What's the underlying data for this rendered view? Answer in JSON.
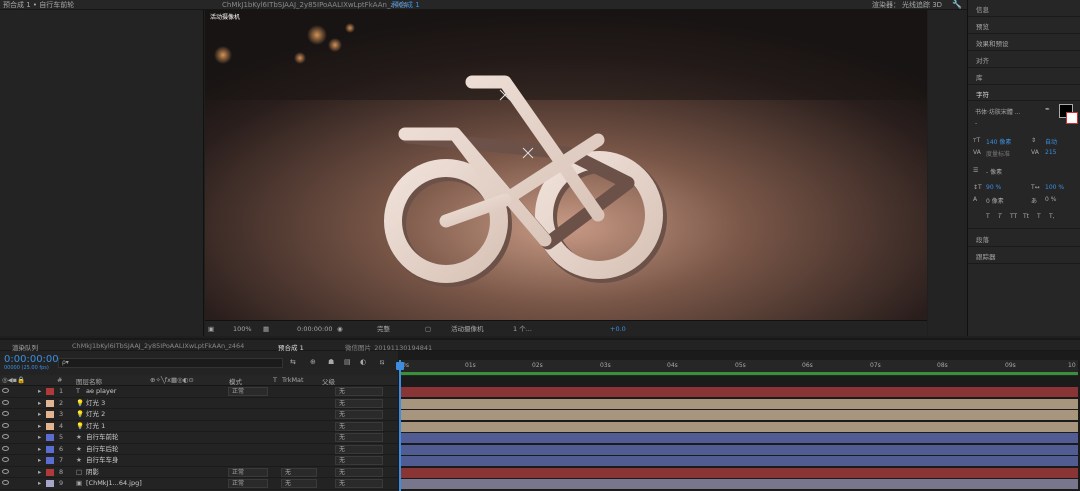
{
  "topbar": {
    "left_title": "预合成 1 • 自行车前轮",
    "comp_tab": "ChMkJ1bKyl6ITbSJAAJ_2y85IPoAALIXwLptFkAAn_z464",
    "active_tab": "预合成 1",
    "renderer_label": "渲染器：",
    "renderer_value": "光线追踪 3D"
  },
  "viewer": {
    "camera_badge": "活动摄像机"
  },
  "viewer_toolbar": {
    "zoom": "100%",
    "timecode": "0:00:00:00",
    "quality": "完整",
    "camera": "活动摄像机",
    "views": "1 个...",
    "exposure": "+0.0"
  },
  "right_panel": {
    "items": [
      "信息",
      "预览",
      "效果和预设",
      "对齐",
      "库",
      "字符"
    ],
    "font_name": "书体·坊肤宋體 ...",
    "font_style": "-",
    "font_size": "140 像素",
    "leading": "自动",
    "tracking_label": "度量标准",
    "tracking_value": "215",
    "stroke_width": "- 像素",
    "vscale": "90 %",
    "hscale": "100 %",
    "baseline": "0 像素",
    "tsume": "0 %",
    "style_buttons": [
      "T",
      "T",
      "TT",
      "Tt",
      "T",
      "T,"
    ],
    "paragraph": "段落",
    "tracker": "跟踪器"
  },
  "timeline": {
    "tabs": [
      "渲染队列",
      "ChMkJ1bKyl6ITbSJAAJ_2y85IPoAALIXwLptFkAAn_z464",
      "预合成 1",
      "微信图片_20191130194841"
    ],
    "timecode": "0:00:00:00",
    "fps_info": "00000 (25.00 fps)",
    "search_placeholder": "ρ▾",
    "columns": {
      "num": "#",
      "name": "图层名称",
      "mode": "模式",
      "t": "T",
      "trkmat": "TrkMat",
      "parent": "父级"
    },
    "ruler": [
      "0s",
      "01s",
      "02s",
      "03s",
      "04s",
      "05s",
      "06s",
      "07s",
      "08s",
      "09s",
      "10"
    ],
    "layers": [
      {
        "num": "1",
        "type": "T",
        "name": "ae player",
        "color": "#b03a3a",
        "mode": "正常",
        "trkmat": "",
        "parent": "无",
        "bar": "#8a3535"
      },
      {
        "num": "2",
        "type": "💡",
        "name": "灯光 3",
        "color": "#e2b592",
        "mode": "",
        "trkmat": "",
        "parent": "无",
        "bar": "#a8957e"
      },
      {
        "num": "3",
        "type": "💡",
        "name": "灯光 2",
        "color": "#e2b592",
        "mode": "",
        "trkmat": "",
        "parent": "无",
        "bar": "#a8957e"
      },
      {
        "num": "4",
        "type": "💡",
        "name": "灯光 1",
        "color": "#e2b592",
        "mode": "",
        "trkmat": "",
        "parent": "无",
        "bar": "#a8957e"
      },
      {
        "num": "5",
        "type": "★",
        "name": "自行车前轮",
        "color": "#5b6dd0",
        "mode": "",
        "trkmat": "",
        "parent": "无",
        "bar": "#515d92"
      },
      {
        "num": "6",
        "type": "★",
        "name": "自行车后轮",
        "color": "#5b6dd0",
        "mode": "",
        "trkmat": "",
        "parent": "无",
        "bar": "#515d92"
      },
      {
        "num": "7",
        "type": "★",
        "name": "自行车车身",
        "color": "#5b6dd0",
        "mode": "",
        "trkmat": "",
        "parent": "无",
        "bar": "#515d92"
      },
      {
        "num": "8",
        "type": "□",
        "name": "阴影",
        "color": "#b03a3a",
        "mode": "正常",
        "trkmat": "无",
        "parent": "无",
        "bar": "#8a3535"
      },
      {
        "num": "9",
        "type": "▣",
        "name": "[ChMkJ1...64.jpg]",
        "color": "#a5a5c8",
        "mode": "正常",
        "trkmat": "无",
        "parent": "无",
        "bar": "#77768c"
      }
    ]
  },
  "colors": {
    "accent": "#3c8fe0",
    "panel": "#232323"
  }
}
